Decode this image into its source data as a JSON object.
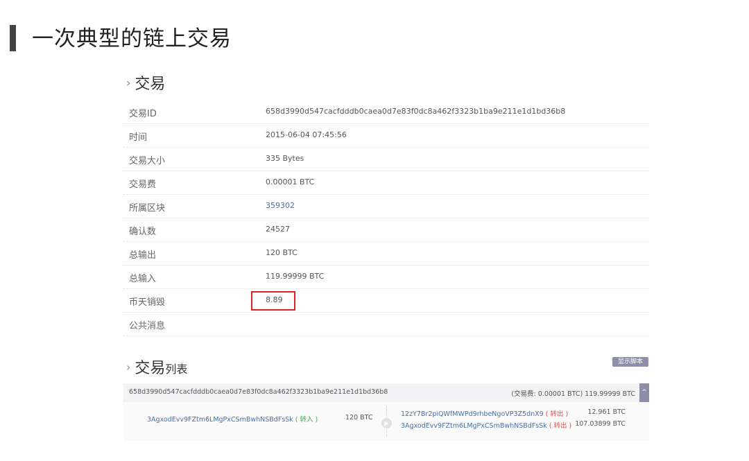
{
  "slide": {
    "title": "一次典型的链上交易"
  },
  "transaction_section": {
    "chevron": "›",
    "title": "交易",
    "rows": [
      {
        "label": "交易ID",
        "value": "658d3990d547cacfdddb0caea0d7e83f0dc8a462f3323b1ba9e211e1d1bd36b8"
      },
      {
        "label": "时间",
        "value": "2015-06-04 07:45:56"
      },
      {
        "label": "交易大小",
        "value": "335 Bytes"
      },
      {
        "label": "交易费",
        "value": "0.00001 BTC"
      },
      {
        "label": "所属区块",
        "value": "359302"
      },
      {
        "label": "确认数",
        "value": "24527"
      },
      {
        "label": "总输出",
        "value": "120 BTC"
      },
      {
        "label": "总输入",
        "value": "119.99999 BTC"
      },
      {
        "label": "币天销毁",
        "value": "8.89"
      },
      {
        "label": "公共消息",
        "value": ""
      }
    ]
  },
  "tx_list_section": {
    "chevron": "›",
    "title_main": "交易",
    "title_sub": "列表",
    "show_script_label": "显示脚本",
    "collapse_icon": "^",
    "tx": {
      "hash": "658d3990d547cacfdddb0caea0d7e83f0dc8a462f3323b1ba9e211e1d1bd36b8",
      "fee_summary": "(交易费: 0.00001 BTC) 119.99999 BTC",
      "input": {
        "address": "3AgxodEvv9FZtm6LMgPxCSmBwhNSBdFsSk",
        "tag": "( 转入 )",
        "amount": "120 BTC"
      },
      "outputs": [
        {
          "address": "12zY7Br2piQWfMWPd9rhbeNgoVP3Z5dnX9",
          "tag": "( 转出 )",
          "amount": "12.961 BTC"
        },
        {
          "address": "3AgxodEvv9FZtm6LMgPxCSmBwhNSBdFsSk",
          "tag": "( 转出 )",
          "amount": "107.03899 BTC"
        }
      ]
    }
  },
  "colors": {
    "highlight_box": "#e02020",
    "link": "#4a6fa0",
    "button": "#8e8ea8"
  }
}
